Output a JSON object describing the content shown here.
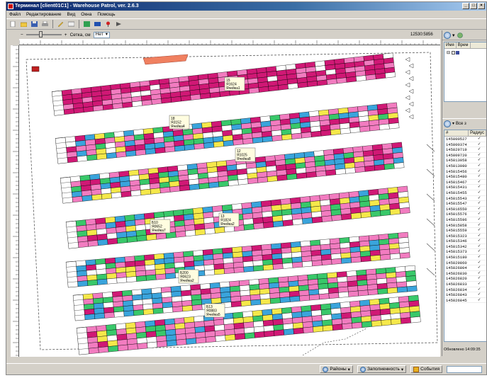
{
  "window": {
    "title": "Терминал [client01C1] - Warehouse Patrol, ver. 2.6.3",
    "controls": [
      "_",
      "□",
      "×"
    ]
  },
  "menu": [
    "Файл",
    "Редактирование",
    "Вид",
    "Окна",
    "Помощь"
  ],
  "toolbar_icons": [
    "new-file-icon",
    "open-folder-icon",
    "save-icon",
    "print-icon",
    "edit-icon",
    "layout-icon",
    "green-grid-icon",
    "blue-grid-icon",
    "pin-icon",
    "arrow-icon"
  ],
  "subtoolbar": {
    "zoom_minus": "−",
    "zoom_plus": "+",
    "grid_label": "Сетка, см",
    "grid_value": "Нет",
    "coordinates": "12530:5856"
  },
  "map_labels": [
    {
      "lines": [
        "15",
        "Я1624",
        "Ячейка1"
      ]
    },
    {
      "lines": [
        "18",
        "Я3152",
        "Ячейка4"
      ]
    },
    {
      "lines": [
        "12",
        "Я1025",
        "Ячейка8"
      ]
    },
    {
      "lines": [
        "Б10",
        "Я0652",
        "Ячейка7"
      ]
    },
    {
      "lines": [
        "13",
        "Я1824",
        "Ячейка2"
      ]
    },
    {
      "lines": [
        "Б200",
        "Я0623",
        "Ячейка2"
      ]
    },
    {
      "lines": [
        "Б13",
        "Я0883",
        "Ячейка5"
      ]
    }
  ],
  "right_pane": {
    "tree_headers": [
      "Имя",
      "Врем"
    ],
    "list_toolbar_label": "Все з",
    "list_headers": [
      "#",
      "Радиус"
    ],
    "rows": [
      "145800527",
      "145800374",
      "145829719",
      "145809720",
      "145813058",
      "145813080",
      "145815456",
      "145815480",
      "145815467",
      "145815431",
      "145815455",
      "145815543",
      "145815547",
      "145816550",
      "145815576",
      "145815596",
      "145815858",
      "145815559",
      "145815323",
      "145815346",
      "145815342",
      "145815373",
      "145815180",
      "145829860",
      "145826804",
      "145826830",
      "145826820",
      "145826833",
      "145826834",
      "145826843",
      "145826845"
    ],
    "status": "Обновлено 14:09:35"
  },
  "statusbar": {
    "tab1": "Районы",
    "tab2": "Заполненность",
    "tab3": "События"
  },
  "colors": {
    "magenta": "#d01875",
    "pink": "#f27cc0",
    "blue": "#3aa4dc",
    "yellow": "#f5e84a",
    "green": "#39c86a",
    "white": "#ffffff"
  }
}
